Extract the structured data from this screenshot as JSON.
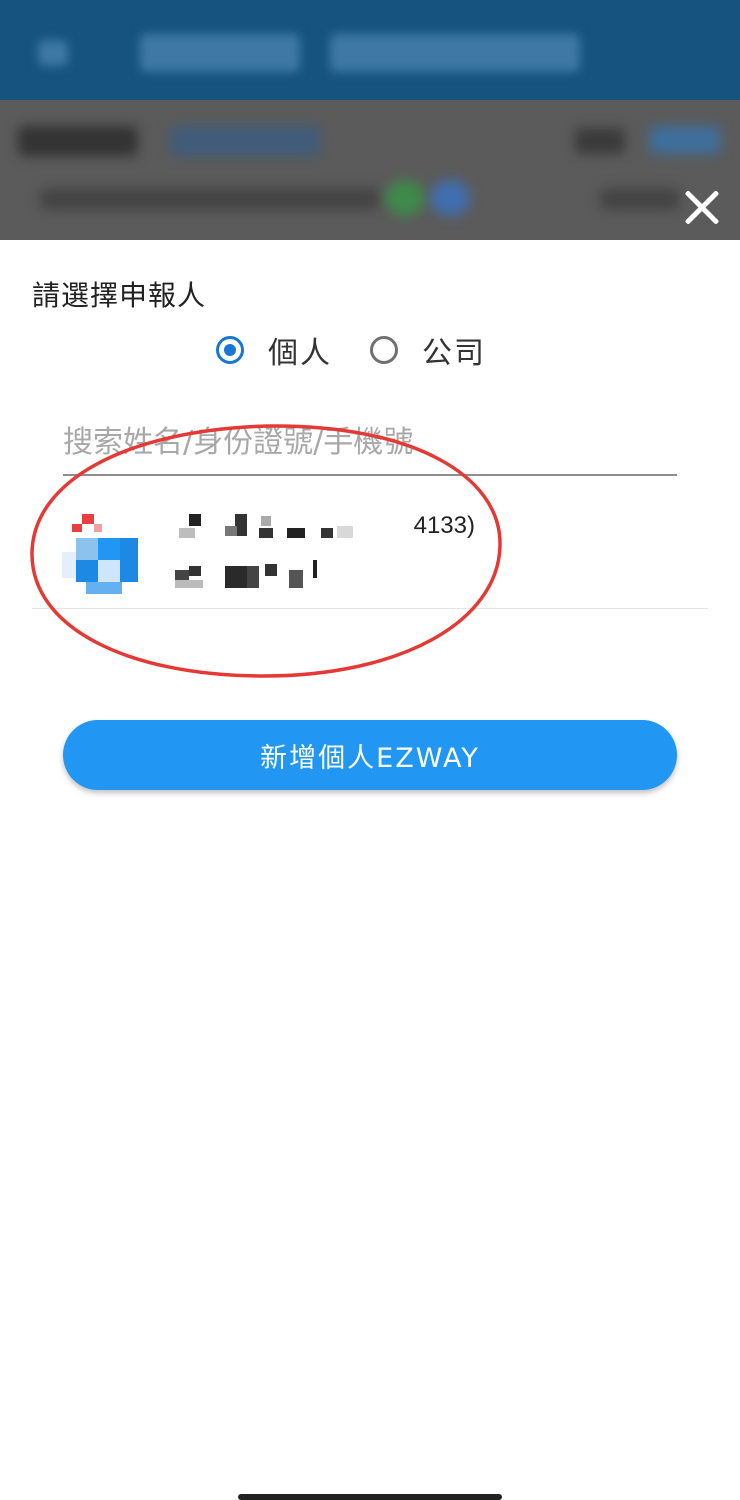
{
  "sheet": {
    "title": "請選擇申報人",
    "radio_options": [
      {
        "label": "個人",
        "checked": true
      },
      {
        "label": "公司",
        "checked": false
      }
    ],
    "search": {
      "placeholder": "搜索姓名/身份證號/手機號",
      "value": ""
    },
    "results": [
      {
        "line1_visible_suffix": "4133)"
      }
    ],
    "add_button_label": "新增個人EZWAY"
  },
  "icons": {
    "close": "close-icon",
    "avatar": "user-avatar"
  },
  "colors": {
    "accent": "#2196f3",
    "radio_checked": "#1976d2",
    "annotation": "#e53935",
    "header_bg": "#16537f"
  }
}
